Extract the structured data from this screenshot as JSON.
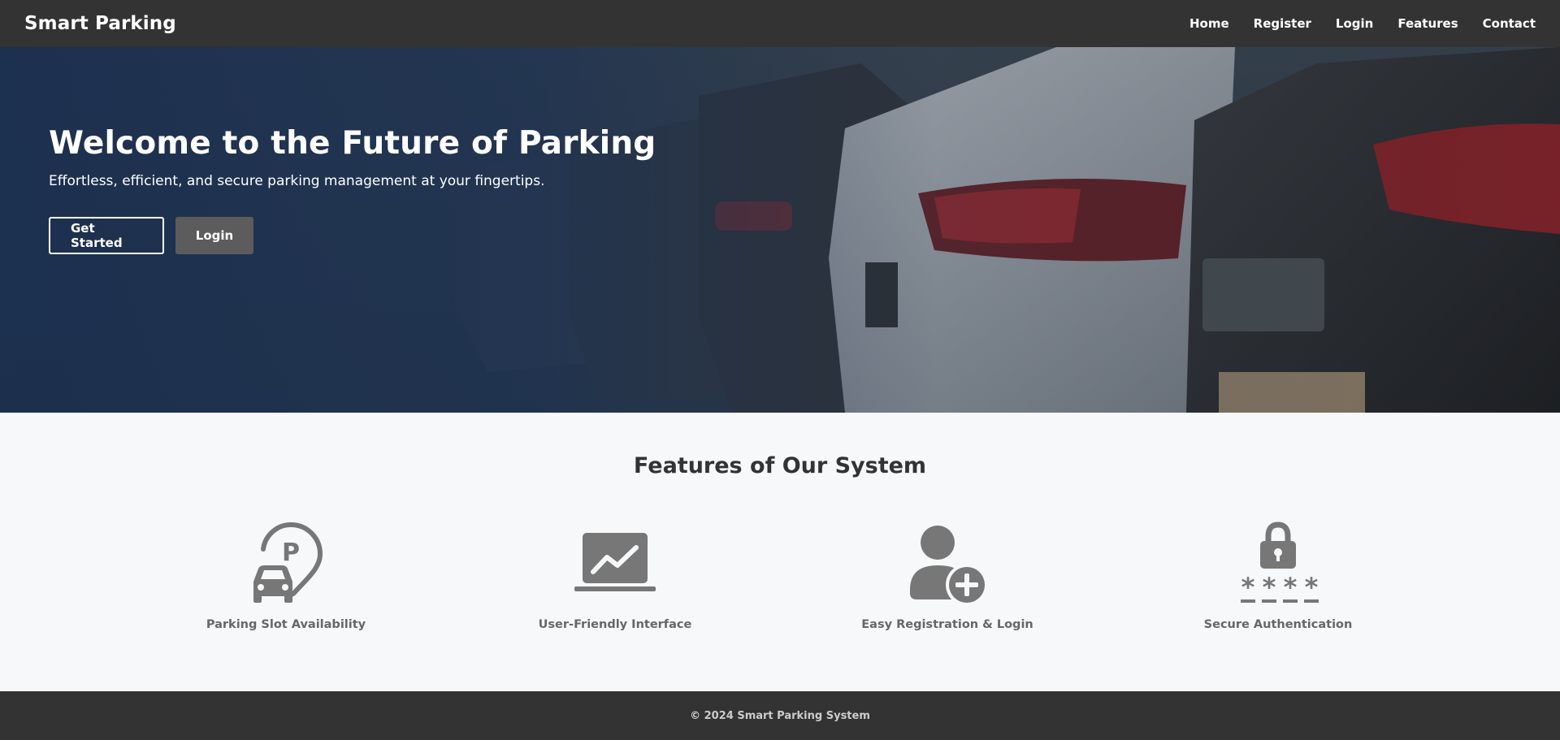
{
  "header": {
    "brand": "Smart Parking",
    "nav": [
      "Home",
      "Register",
      "Login",
      "Features",
      "Contact"
    ]
  },
  "hero": {
    "title": "Welcome to the Future of Parking",
    "subtitle": "Effortless, efficient, and secure parking management at your fingertips.",
    "primary_button": "Get Started",
    "secondary_button": "Login"
  },
  "features": {
    "title": "Features of Our System",
    "items": [
      {
        "label": "Parking Slot Availability",
        "icon": "parking-car-icon"
      },
      {
        "label": "User-Friendly Interface",
        "icon": "laptop-chart-icon"
      },
      {
        "label": "Easy Registration & Login",
        "icon": "user-add-icon"
      },
      {
        "label": "Secure Authentication",
        "icon": "lock-password-icon"
      }
    ]
  },
  "footer": {
    "text": "© 2024 Smart Parking System"
  },
  "colors": {
    "nav_bg": "#333333",
    "hero_overlay": "#1c3050",
    "feature_icon": "#777777",
    "page_bg": "#f6f8fa"
  }
}
